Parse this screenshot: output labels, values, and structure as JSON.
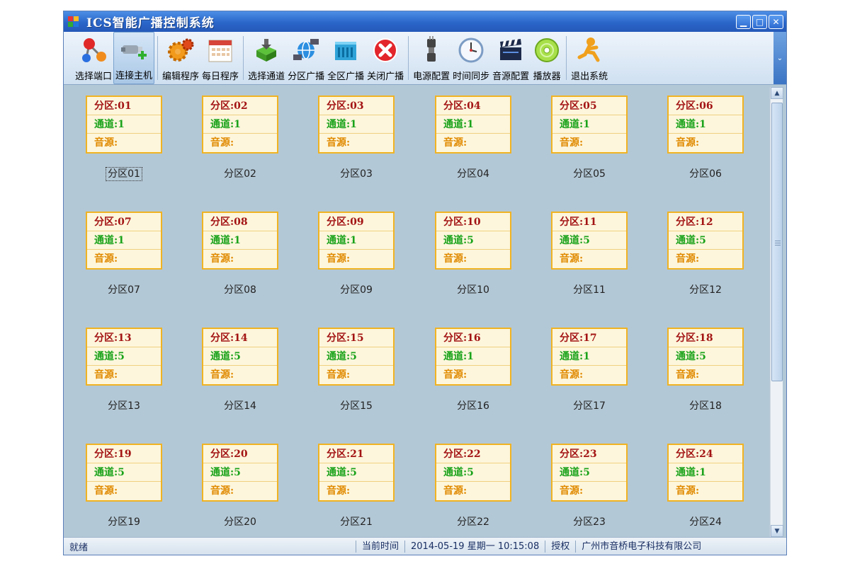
{
  "window": {
    "title": "ICS智能广播控制系统"
  },
  "toolbar": {
    "items": [
      {
        "label": "选择端口",
        "icon": "molecule-icon"
      },
      {
        "label": "连接主机",
        "icon": "connector-plus-icon"
      },
      {
        "label": "编辑程序",
        "icon": "gears-icon"
      },
      {
        "label": "每日程序",
        "icon": "calendar-icon"
      },
      {
        "label": "选择通道",
        "icon": "install-box-icon"
      },
      {
        "label": "分区广播",
        "icon": "globe-network-icon"
      },
      {
        "label": "全区广播",
        "icon": "broadcast-bars-icon"
      },
      {
        "label": "关闭广播",
        "icon": "close-circle-icon"
      },
      {
        "label": "电源配置",
        "icon": "power-plug-icon"
      },
      {
        "label": "时间同步",
        "icon": "clock-icon"
      },
      {
        "label": "音源配置",
        "icon": "clapperboard-icon"
      },
      {
        "label": "播放器",
        "icon": "disc-icon"
      },
      {
        "label": "退出系统",
        "icon": "running-man-icon"
      }
    ]
  },
  "zones": [
    {
      "name": "分区:01",
      "channel": "通道:1",
      "source": "音源:",
      "caption": "分区01"
    },
    {
      "name": "分区:02",
      "channel": "通道:1",
      "source": "音源:",
      "caption": "分区02"
    },
    {
      "name": "分区:03",
      "channel": "通道:1",
      "source": "音源:",
      "caption": "分区03"
    },
    {
      "name": "分区:04",
      "channel": "通道:1",
      "source": "音源:",
      "caption": "分区04"
    },
    {
      "name": "分区:05",
      "channel": "通道:1",
      "source": "音源:",
      "caption": "分区05"
    },
    {
      "name": "分区:06",
      "channel": "通道:1",
      "source": "音源:",
      "caption": "分区06"
    },
    {
      "name": "分区:07",
      "channel": "通道:1",
      "source": "音源:",
      "caption": "分区07"
    },
    {
      "name": "分区:08",
      "channel": "通道:1",
      "source": "音源:",
      "caption": "分区08"
    },
    {
      "name": "分区:09",
      "channel": "通道:1",
      "source": "音源:",
      "caption": "分区09"
    },
    {
      "name": "分区:10",
      "channel": "通道:5",
      "source": "音源:",
      "caption": "分区10"
    },
    {
      "name": "分区:11",
      "channel": "通道:5",
      "source": "音源:",
      "caption": "分区11"
    },
    {
      "name": "分区:12",
      "channel": "通道:5",
      "source": "音源:",
      "caption": "分区12"
    },
    {
      "name": "分区:13",
      "channel": "通道:5",
      "source": "音源:",
      "caption": "分区13"
    },
    {
      "name": "分区:14",
      "channel": "通道:5",
      "source": "音源:",
      "caption": "分区14"
    },
    {
      "name": "分区:15",
      "channel": "通道:5",
      "source": "音源:",
      "caption": "分区15"
    },
    {
      "name": "分区:16",
      "channel": "通道:1",
      "source": "音源:",
      "caption": "分区16"
    },
    {
      "name": "分区:17",
      "channel": "通道:1",
      "source": "音源:",
      "caption": "分区17"
    },
    {
      "name": "分区:18",
      "channel": "通道:5",
      "source": "音源:",
      "caption": "分区18"
    },
    {
      "name": "分区:19",
      "channel": "通道:5",
      "source": "音源:",
      "caption": "分区19"
    },
    {
      "name": "分区:20",
      "channel": "通道:5",
      "source": "音源:",
      "caption": "分区20"
    },
    {
      "name": "分区:21",
      "channel": "通道:5",
      "source": "音源:",
      "caption": "分区21"
    },
    {
      "name": "分区:22",
      "channel": "通道:5",
      "source": "音源:",
      "caption": "分区22"
    },
    {
      "name": "分区:23",
      "channel": "通道:5",
      "source": "音源:",
      "caption": "分区23"
    },
    {
      "name": "分区:24",
      "channel": "通道:1",
      "source": "音源:",
      "caption": "分区24"
    }
  ],
  "status": {
    "ready": "就绪",
    "time_label": "当前时间",
    "datetime": "2014-05-19  星期一  10:15:08",
    "auth": "授权",
    "company": "广州市音桥电子科技有限公司"
  },
  "colors": {
    "zone_name": "#a31414",
    "zone_channel": "#1ba31b",
    "zone_source": "#e08a00",
    "zone_border": "#f0b323",
    "background": "#b3c8d6"
  }
}
